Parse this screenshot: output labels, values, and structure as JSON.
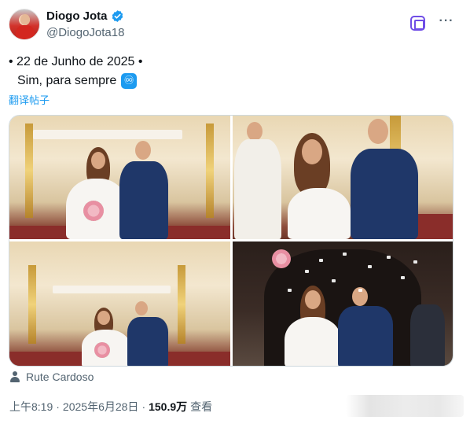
{
  "author": {
    "display_name": "Diogo Jota",
    "handle": "@DiogoJota18",
    "verified": true
  },
  "tweet": {
    "line1": "• 22 de Junho de 2025 •",
    "line2": "Sim, para sempre",
    "emoji": "♾",
    "translate_label": "翻译帖子"
  },
  "photo_credit": "Rute Cardoso",
  "meta": {
    "time": "上午8:19",
    "separator1": "·",
    "date": "2025年6月28日",
    "separator2": "·",
    "views": "150.9万",
    "views_label": "查看"
  },
  "colors": {
    "accent": "#1d9bf0",
    "grok": "#6f4de6",
    "text_primary": "#0f1419",
    "text_secondary": "#536471"
  },
  "icons": [
    "verified-badge-icon",
    "grok-icon",
    "more-icon",
    "infinity-icon",
    "person-icon"
  ]
}
